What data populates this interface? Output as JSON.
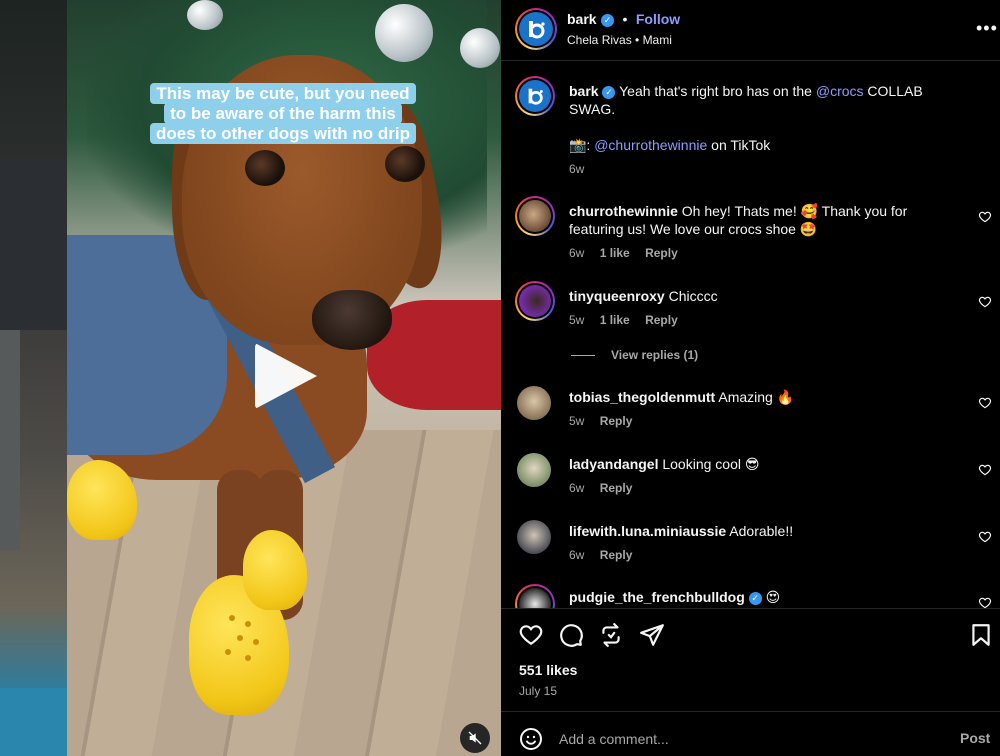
{
  "media": {
    "caption": "This may be cute, but you need to be aware of the harm this does to other dogs with no drip",
    "play_icon": "play-icon",
    "mute_icon": "mute-icon"
  },
  "header": {
    "username": "bark",
    "follow_label": "Follow",
    "separator": "•",
    "audio": "Chela Rivas • Mami",
    "more_icon": "more-icon"
  },
  "caption_post": {
    "username": "bark",
    "text_before": "Yeah that's right bro has on the ",
    "mention": "@crocs",
    "text_after": " COLLAB SWAG.",
    "credit_prefix": "📸: ",
    "credit_mention": "@churrothewinnie",
    "credit_suffix": " on TikTok",
    "time": "6w"
  },
  "comments": [
    {
      "username": "churrothewinnie",
      "text": "Oh hey! Thats me! 🥰 Thank you for featuring us! We love our crocs shoe 🤩",
      "time": "6w",
      "likes": "1 like",
      "reply": "Reply"
    },
    {
      "username": "tinyqueenroxy",
      "text": "Chicccc",
      "time": "5w",
      "likes": "1 like",
      "reply": "Reply"
    },
    {
      "username": "tobias_thegoldenmutt",
      "text": "Amazing 🔥",
      "time": "5w",
      "reply": "Reply"
    },
    {
      "username": "ladyandangel",
      "text": "Looking cool 😎",
      "time": "6w",
      "reply": "Reply"
    },
    {
      "username": "lifewith.luna.miniaussie",
      "text": "Adorable!!",
      "time": "6w",
      "reply": "Reply"
    },
    {
      "username": "pudgie_the_frenchbulldog",
      "text": "😍"
    }
  ],
  "view_replies": "View replies (1)",
  "likes": "551 likes",
  "date": "July 15",
  "add_comment": {
    "placeholder": "Add a comment...",
    "post_label": "Post"
  },
  "colors": {
    "accent": "#8c9cff",
    "verified": "#3897f0",
    "background": "#000000",
    "muted_text": "#a8a8a8"
  }
}
